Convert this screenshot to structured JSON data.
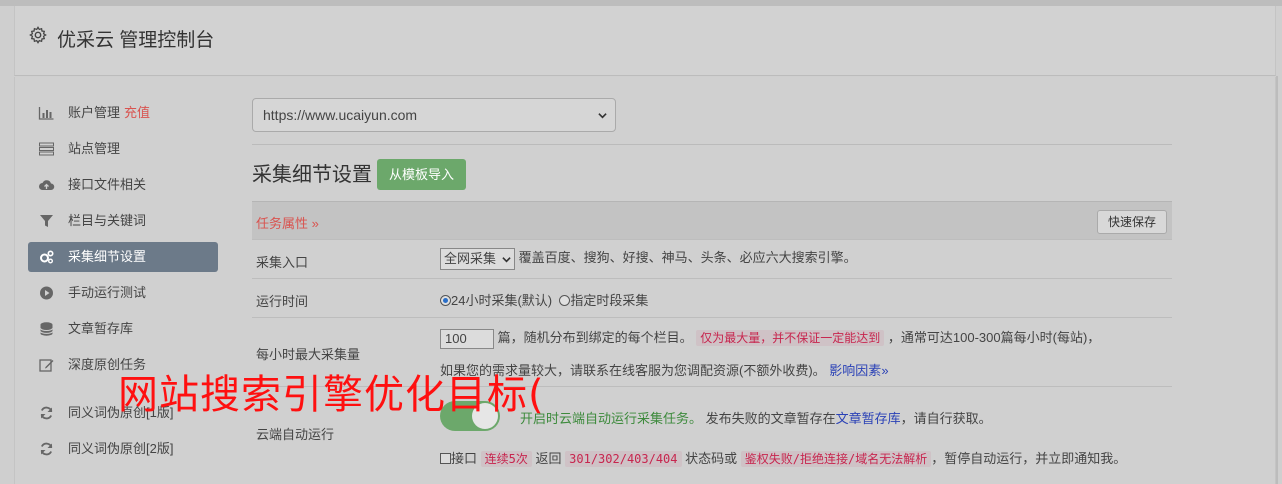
{
  "header": {
    "title": "优采云 管理控制台",
    "icon": "gear-icon"
  },
  "sidebar": {
    "items": [
      {
        "label": "账户管理",
        "extra": "充值",
        "icon": "bar-chart-icon"
      },
      {
        "label": "站点管理",
        "icon": "server-icon"
      },
      {
        "label": "接口文件相关",
        "icon": "cloud-upload-icon"
      },
      {
        "label": "栏目与关键词",
        "icon": "filter-icon"
      },
      {
        "label": "采集细节设置",
        "icon": "cogs-icon",
        "active": true
      },
      {
        "label": "手动运行测试",
        "icon": "play-circle-icon"
      },
      {
        "label": "文章暂存库",
        "icon": "database-icon"
      },
      {
        "label": "深度原创任务",
        "icon": "edit-icon"
      },
      {
        "label": "同义词伪原创[1版]",
        "icon": "refresh-icon"
      },
      {
        "label": "同义词伪原创[2版]",
        "icon": "refresh-icon"
      }
    ]
  },
  "main": {
    "site_select": "https://www.ucaiyun.com",
    "section_title": "采集细节设置",
    "import_button": "从模板导入",
    "task_attr": "任务属性",
    "save_button": "快速保存",
    "rows": {
      "entry": {
        "key": "采集入口",
        "select": "全网采集",
        "desc": "覆盖百度、搜狗、好搜、神马、头条、必应六大搜索引擎。"
      },
      "time": {
        "key": "运行时间",
        "opt1": "24小时采集(默认)",
        "opt2": "指定时段采集"
      },
      "max": {
        "key": "每小时最大采集量",
        "value": "100",
        "t1": "篇，随机分布到绑定的每个栏目。",
        "code": "仅为最大量，并不保证一定能达到",
        "t2": "，通常可达100-300篇每小时(每站)，",
        "t3": "如果您的需求量较大，请联系在线客服为您调配资源(不额外收费)。",
        "link": "影响因素"
      },
      "cloud": {
        "key": "云端自动运行",
        "green": "开启时云端自动运行采集任务。",
        "t1": "发布失败的文章暂存在",
        "link": "文章暂存库",
        "t2": "，请自行获取。",
        "cb_label": "接口",
        "code1": "连续5次",
        "t3": "返回",
        "code2": "301/302/403/404",
        "t4": "状态码或",
        "code3": "鉴权失败/拒绝连接/域名无法解析",
        "t5": "，暂停自动运行，并立即通知我。"
      }
    }
  },
  "watermark": "网站搜索引擎优化目标(",
  "colors": {
    "accent_red": "#d9534f",
    "green": "#6ca86b",
    "active": "#6c7a89"
  }
}
